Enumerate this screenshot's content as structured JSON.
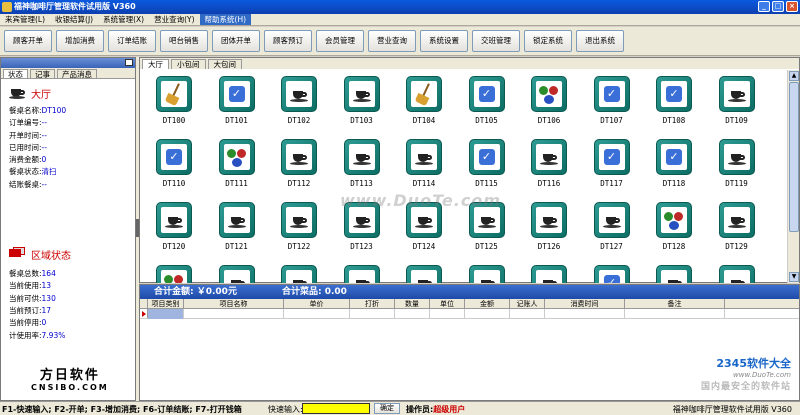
{
  "window": {
    "title": "福神咖啡厅管理软件试用版 V360"
  },
  "menu": [
    "来宾管理(L)",
    "收银结算(J)",
    "系统管理(X)",
    "营业查询(Y)",
    "帮助系统(H)"
  ],
  "toolbar": [
    "顾客开单",
    "增加消费",
    "订单结账",
    "吧台销售",
    "团体开单",
    "顾客预订",
    "会员管理",
    "营业查询",
    "系统设置",
    "交班管理",
    "锁定系统",
    "退出系统"
  ],
  "left": {
    "tabs": [
      "状态",
      "记事",
      "产品消息"
    ],
    "hall_title": "大厅",
    "hall_info": [
      {
        "label": "餐桌名称:",
        "value": "DT100"
      },
      {
        "label": "订单编号:",
        "value": "--"
      },
      {
        "label": "开单时间:",
        "value": "--"
      },
      {
        "label": "已用时间:",
        "value": "--"
      },
      {
        "label": "消费金额:",
        "value": "0"
      },
      {
        "label": "餐桌状态:",
        "value": "清扫"
      },
      {
        "label": "结账餐桌:",
        "value": "--"
      }
    ],
    "zone_title": "区域状态",
    "zone_info": [
      {
        "label": "餐桌总数:",
        "value": "164"
      },
      {
        "label": "当前使用:",
        "value": "13"
      },
      {
        "label": "当前可供:",
        "value": "130"
      },
      {
        "label": "当前预订:",
        "value": "17"
      },
      {
        "label": "当前停用:",
        "value": "0"
      },
      {
        "label": "计使用率:",
        "value": "7.93%"
      }
    ],
    "logo_main": "方日软件",
    "logo_sub": "CNSIBO.COM"
  },
  "rooms": {
    "tabs": [
      "大厅",
      "小包间",
      "大包间"
    ]
  },
  "tables": [
    {
      "id": "DT100",
      "icon": "broom-icon"
    },
    {
      "id": "DT101",
      "icon": "check-icon"
    },
    {
      "id": "DT102",
      "icon": "coffee-cup-icon"
    },
    {
      "id": "DT103",
      "icon": "coffee-cup-icon"
    },
    {
      "id": "DT104",
      "icon": "broom-icon"
    },
    {
      "id": "DT105",
      "icon": "check-icon"
    },
    {
      "id": "DT106",
      "icon": "people-icon"
    },
    {
      "id": "DT107",
      "icon": "check-icon"
    },
    {
      "id": "DT108",
      "icon": "check-icon"
    },
    {
      "id": "DT109",
      "icon": "coffee-cup-icon"
    },
    {
      "id": "DT110",
      "icon": "check-icon"
    },
    {
      "id": "DT111",
      "icon": "people-icon"
    },
    {
      "id": "DT112",
      "icon": "coffee-cup-icon"
    },
    {
      "id": "DT113",
      "icon": "coffee-cup-icon"
    },
    {
      "id": "DT114",
      "icon": "coffee-cup-icon"
    },
    {
      "id": "DT115",
      "icon": "check-icon"
    },
    {
      "id": "DT116",
      "icon": "coffee-cup-icon"
    },
    {
      "id": "DT117",
      "icon": "check-icon"
    },
    {
      "id": "DT118",
      "icon": "check-icon"
    },
    {
      "id": "DT119",
      "icon": "coffee-cup-icon"
    },
    {
      "id": "DT120",
      "icon": "coffee-cup-icon"
    },
    {
      "id": "DT121",
      "icon": "coffee-cup-icon"
    },
    {
      "id": "DT122",
      "icon": "coffee-cup-icon"
    },
    {
      "id": "DT123",
      "icon": "coffee-cup-icon"
    },
    {
      "id": "DT124",
      "icon": "coffee-cup-icon"
    },
    {
      "id": "DT125",
      "icon": "coffee-cup-icon"
    },
    {
      "id": "DT126",
      "icon": "coffee-cup-icon"
    },
    {
      "id": "DT127",
      "icon": "coffee-cup-icon"
    },
    {
      "id": "DT128",
      "icon": "people-icon"
    },
    {
      "id": "DT129",
      "icon": "coffee-cup-icon"
    },
    {
      "id": "",
      "icon": "people-icon"
    },
    {
      "id": "",
      "icon": "coffee-cup-icon"
    },
    {
      "id": "",
      "icon": "coffee-cup-icon"
    },
    {
      "id": "",
      "icon": "coffee-cup-icon"
    },
    {
      "id": "",
      "icon": "coffee-cup-icon"
    },
    {
      "id": "",
      "icon": "coffee-cup-icon"
    },
    {
      "id": "",
      "icon": "coffee-cup-icon"
    },
    {
      "id": "",
      "icon": "check-icon"
    },
    {
      "id": "",
      "icon": "coffee-cup-icon"
    },
    {
      "id": "",
      "icon": "coffee-cup-icon"
    }
  ],
  "order": {
    "total_amount": "合计金额: ￥0.00元",
    "total_items": "合计菜品: 0.00",
    "columns": [
      "项目类别",
      "项目名称",
      "单价",
      "打折",
      "数量",
      "单位",
      "金额",
      "记账人",
      "消费时间",
      "备注"
    ]
  },
  "watermarks": {
    "center": "www.DuoTe.com",
    "brand": "2345软件大全",
    "url": "www.DuoTe.com",
    "slogan": "国内最安全的软件站"
  },
  "status": {
    "hotkeys": "F1-快速输入; F2-开单; F3-增加消费; F6-订单结账; F7-打开钱箱",
    "quick_label": "快速输入:",
    "ok": "确定",
    "operator_label": "操作员:",
    "operator": "超级用户",
    "version": "福神咖啡厅管理软件试用版 V360"
  }
}
